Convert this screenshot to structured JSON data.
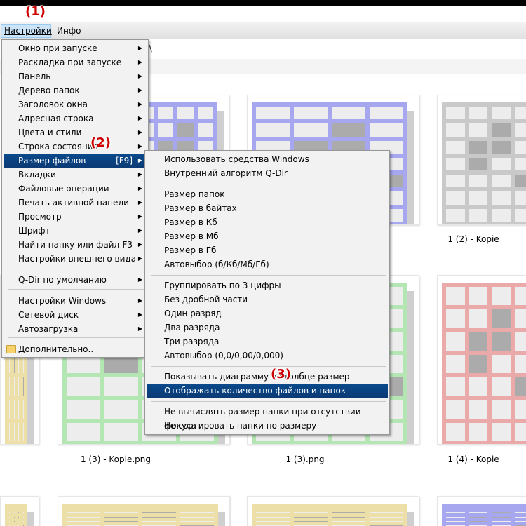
{
  "menubar": {
    "settings": "Настройки",
    "info": "Инфо"
  },
  "address": {
    "path_fragment": "2\\"
  },
  "annotations": {
    "a1": "(1)",
    "a2": "(2)",
    "a3": "(3)"
  },
  "main_menu": {
    "items": [
      {
        "label": "Окно при запуске",
        "arrow": true
      },
      {
        "label": "Раскладка при запуске",
        "arrow": true
      },
      {
        "label": "Панель",
        "arrow": true
      },
      {
        "label": "Дерево папок",
        "arrow": true
      },
      {
        "label": "Заголовок окна",
        "arrow": true
      },
      {
        "label": "Адресная строка",
        "arrow": true
      },
      {
        "label": "Цвета и стили",
        "arrow": true
      },
      {
        "label": "Строка состояния",
        "arrow": true
      },
      {
        "label": "Размер файлов",
        "shortcut": "[F9]",
        "arrow": true,
        "highlighted": true
      },
      {
        "label": "Вкладки",
        "arrow": true
      },
      {
        "label": "Файловые операции",
        "arrow": true
      },
      {
        "label": "Печать активной панели",
        "arrow": true
      },
      {
        "label": "Просмотр",
        "arrow": true
      },
      {
        "label": "Шрифт",
        "arrow": true
      },
      {
        "label": "Найти папку или файл",
        "shortcut": "F3",
        "arrow": true
      },
      {
        "label": "Настройки внешнего вида",
        "arrow": true
      },
      {
        "label": "Q-Dir по умолчанию",
        "arrow": true
      },
      {
        "label": "Настройки Windows",
        "arrow": true
      },
      {
        "label": "Сетевой диск",
        "arrow": true
      },
      {
        "label": "Автозагрузка",
        "arrow": true
      },
      {
        "label": "Дополнительно..",
        "icon": "folder-icon"
      }
    ]
  },
  "submenu": {
    "items": [
      {
        "label": "Использовать средства Windows"
      },
      {
        "label": "Внутренний алгоритм Q-Dir"
      },
      {
        "label": "Размер папок"
      },
      {
        "label": "Размер в байтах"
      },
      {
        "label": "Размер в Кб"
      },
      {
        "label": "Размер в Мб"
      },
      {
        "label": "Размер в Гб"
      },
      {
        "label": "Автовыбор (б/Кб/Мб/Гб)"
      },
      {
        "label": "Группировать по 3 цифры"
      },
      {
        "label": "Без дробной части"
      },
      {
        "label": "Один разряд"
      },
      {
        "label": "Два разряда"
      },
      {
        "label": "Три разряда"
      },
      {
        "label": "Автовыбор (0,0/0,00/0,000)"
      },
      {
        "label": "Показывать диаграмму в столбце размер"
      },
      {
        "label": "Отображать количество файлов и папок",
        "highlighted": true
      },
      {
        "label": "Не вычислять размер папки при отсутствии фокуса"
      },
      {
        "label": "Не сортировать папки по размеру"
      }
    ]
  },
  "files": [
    {
      "caption": "",
      "color": "#a7a7f0"
    },
    {
      "caption": "",
      "color": "#a7a7f0"
    },
    {
      "caption": "1 (2) - Kopie",
      "color": "#c9c9c9"
    },
    {
      "caption": "1 (3) - Kopie.png",
      "color": "#b4e6b4"
    },
    {
      "caption": "1 (3).png",
      "color": "#b4e6b4"
    },
    {
      "caption": "1 (4) - Kopie",
      "color": "#eaaaaa"
    },
    {
      "caption": "",
      "color": "#ecdfa8"
    },
    {
      "caption": "",
      "color": "#ecdfa8"
    },
    {
      "caption": "",
      "color": "#ecdfa8"
    },
    {
      "caption": "",
      "color": "#ecdfa8"
    },
    {
      "caption": "",
      "color": "#a7a7f0"
    }
  ]
}
